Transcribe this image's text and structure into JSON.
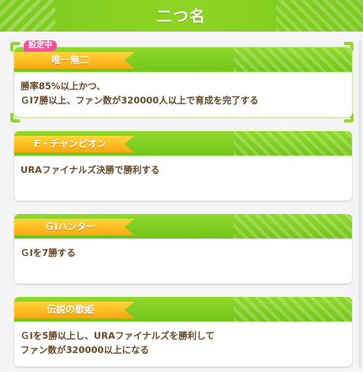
{
  "header": {
    "title": "二つ名"
  },
  "colors": {
    "accent_green": "#7bcb1e",
    "tag_orange": "#fca60f",
    "badge_pink": "#ff4f9a",
    "text_brown": "#6b4a26"
  },
  "selected_badge": "設定中",
  "titles": [
    {
      "name": "唯一無二",
      "desc_lines": [
        "勝率85%以上かつ、",
        "ＧⅠ7勝以上、ファン数が320000人以上で育成を完了する"
      ],
      "selected": true
    },
    {
      "name": "F・チャンピオン",
      "desc_lines": [
        "URAファイナルズ決勝で勝利する"
      ]
    },
    {
      "name": "ＧⅠハンター",
      "desc_lines": [
        "ＧⅠを7勝する"
      ]
    },
    {
      "name": "伝説の歌姫",
      "desc_lines": [
        "ＧⅠを5勝以上し、URAファイナルズを勝利して",
        "ファン数が320000以上になる"
      ]
    }
  ]
}
